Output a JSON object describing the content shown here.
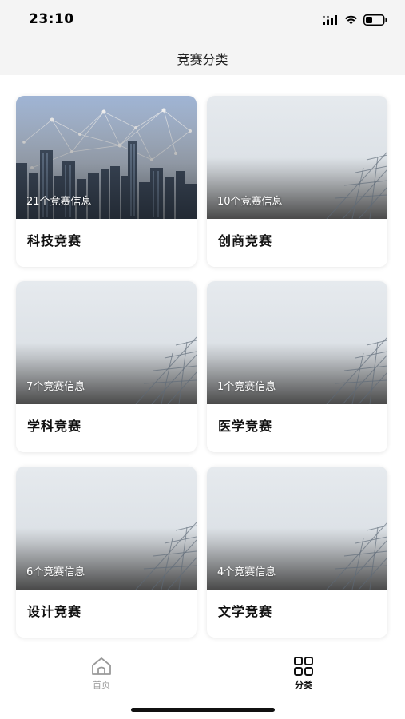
{
  "status_bar": {
    "time": "23:10"
  },
  "header": {
    "title": "竞赛分类"
  },
  "categories": [
    {
      "title": "科技竞赛",
      "count_text": "21个竞赛信息",
      "image": "city-skyline-network"
    },
    {
      "title": "创商竞赛",
      "count_text": "10个竞赛信息",
      "image": "glass-building"
    },
    {
      "title": "学科竞赛",
      "count_text": "7个竞赛信息",
      "image": "glass-building"
    },
    {
      "title": "医学竞赛",
      "count_text": "1个竞赛信息",
      "image": "glass-building"
    },
    {
      "title": "设计竞赛",
      "count_text": "6个竞赛信息",
      "image": "glass-building"
    },
    {
      "title": "文学竞赛",
      "count_text": "4个竞赛信息",
      "image": "glass-building"
    }
  ],
  "tabbar": {
    "tabs": [
      {
        "label": "首页",
        "icon": "home-icon",
        "active": false
      },
      {
        "label": "分类",
        "icon": "grid-icon",
        "active": true
      }
    ]
  },
  "colors": {
    "active_tab": "#111111",
    "inactive_tab": "#999999",
    "header_bg": "#f4f4f4"
  }
}
